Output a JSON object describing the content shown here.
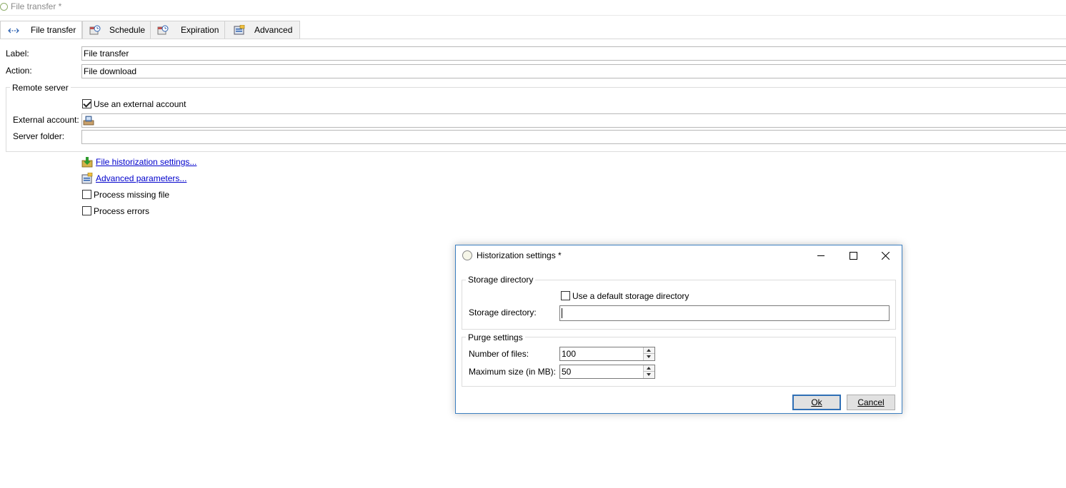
{
  "window": {
    "title": "File transfer *"
  },
  "tabs": [
    {
      "label": "File transfer",
      "icon": "double-arrow-icon",
      "active": true
    },
    {
      "label": "Schedule",
      "icon": "schedule-icon",
      "active": false
    },
    {
      "label": "Expiration",
      "icon": "expiration-icon",
      "active": false
    },
    {
      "label": "Advanced",
      "icon": "advanced-settings-icon",
      "active": false
    }
  ],
  "form": {
    "label_caption": "Label:",
    "label_value": "File transfer",
    "action_caption": "Action:",
    "action_value": "File download",
    "remote_server": {
      "group_title": "Remote server",
      "use_external_account": {
        "label": "Use an external account",
        "checked": true
      },
      "external_account_caption": "External account:",
      "external_account_value": "",
      "server_folder_caption": "Server folder:",
      "server_folder_value": ""
    },
    "links": {
      "historization": "File historization settings...",
      "advanced_parameters": "Advanced parameters..."
    },
    "process_missing_file": {
      "label": "Process missing file",
      "checked": false
    },
    "process_errors": {
      "label": "Process errors",
      "checked": false
    }
  },
  "dialog": {
    "title": "Historization settings *",
    "storage": {
      "group_title": "Storage directory",
      "use_default": {
        "label": "Use a default storage directory",
        "checked": false
      },
      "directory_caption": "Storage directory:",
      "directory_value": ""
    },
    "purge": {
      "group_title": "Purge settings",
      "files_caption": "Number of files:",
      "files_value": "100",
      "size_caption": "Maximum size (in MB):",
      "size_value": "50"
    },
    "ok_label": "Ok",
    "cancel_label": "Cancel"
  },
  "colors": {
    "link": "#0000cc",
    "dialog_border": "#3c7fc1",
    "default_button_border": "#2f6fb5"
  }
}
